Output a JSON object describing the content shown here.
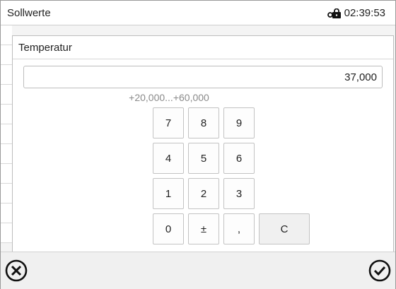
{
  "header": {
    "title": "Sollwerte",
    "time": "02:39:53",
    "lock_icon": "lock-icon"
  },
  "dialog": {
    "title": "Temperatur",
    "value": "37,000",
    "range": "+20,000...+60,000"
  },
  "keypad": {
    "keys": [
      "7",
      "8",
      "9",
      "4",
      "5",
      "6",
      "1",
      "2",
      "3",
      "0",
      "±",
      ",",
      "C"
    ]
  },
  "footer": {
    "cancel_icon": "cancel-circle-icon",
    "ok_icon": "check-circle-icon"
  }
}
